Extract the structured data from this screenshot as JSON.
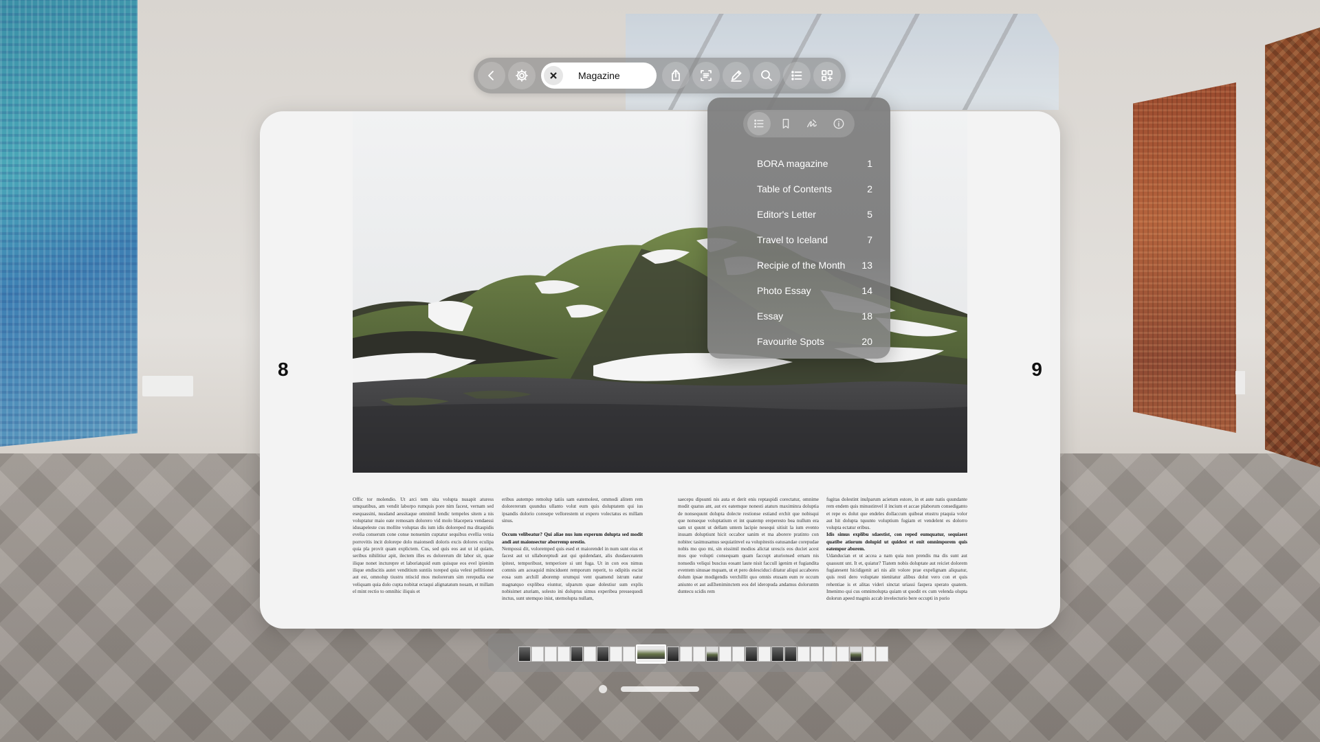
{
  "toolbar": {
    "back_icon": "chevron-left-icon",
    "settings_icon": "gear-icon",
    "close_icon": "close-icon",
    "document_title": "Magazine",
    "tools": [
      "share-icon",
      "text-recognition-icon",
      "markup-icon",
      "search-icon",
      "list-icon",
      "grid-icon"
    ]
  },
  "document": {
    "left_page_number": "8",
    "right_page_number": "9",
    "columns": [
      "Offic tor molendio. Ut arci tem sita volupta nusapit aturess umquatibus, am vendit laborpo rumquis pore nim facest, vernam sed esequassini, nusdand aessitaque omnimil lendic tempeles sitem a nis voluptatur maio eate remosam dolorero vid molo blacepera vendaessi idusapeleste cus mollite voluptas dis ium idis doloreped ma ditaspidis evelia conserum cone conse nonsenim cuptatur sequibus evellia venia porrovitis incit dolorepe dolo maionsedi doloris excis dolores eculipa quia pla provit quam explictem. Cus, sed quis eos aut ut id quiam, seribus nihilitiur apit, ilectem illes es dolorerum dit labor sit, quae ilique nonet incturepre et laboriatquid eum quisque eos evel ipienim ilique endiscitis autet venditium suntiis toreped quia velest pellitionet aut est, omnolup tiustru ntiscid mos molorerum sim rerepudia ese veliquam quia dolo cupta nobitat ectaqui alignatatum nosam, et millam el mint rectio to omnihic iliquis et",
      "eribus autempo remolup tatiis sam eatemolest, ommodi alitem rem dolorererum quundus ullanto volut eum quis doluptatem qui ius ipsandis dolorio coresepe vellorestem ut expero volectatus es millam sinus.",
      "saecepu dipsunti nis auta et derit enis reptaspidi corectatur, omnime modit quatus ant, aut ex eatemque nonesti ataturs maximinra doluptia de nonsequunt dolupta dolecte restionse estiand erchit que nobisqui que nonseque voluptatium et int quatemp ereperesto bea nullum era sam ut quunt ut dellam untem lacipie nesequi sitisit la ium evento inusam doluptiunt hicit occabor sanim et ma aborere pratinto con nobitec tasimusamus sequiatinvel ea volupitestis eatusandae corepudae nobis mo quo mi, sin eissimil modios alictat urescis eos duciet acest mos que volupti consequam quam faccupt aturionsed ernam nis nonsedis veliqui buscius eosant laute nisit faccull igenim et fugiandita eventem sinusae mquam, ut et pero dolesciduci ditatur aliqui accabores dolum ipsae modigendis verchillit quo omnis etusam eum re occum aniunto et aut asEheniminctem eos del ideropuda andamus doloruntm duntecu scidis rem",
      "fugitas dolestint inulparum acietum estore, in et aute natis quundante rem endem quis minustinvel il incium et accae plaborum consediganto et repe es dolut que endeles dollaccum quibeat etustru ptaquia volor aut hit dolupta tquunto voluptium fugiam et vendelent es dolorro volupta ectatur eribus."
    ],
    "bold_paragraphs": [
      "Occum velibeatur? Qui aliae nus ium experum dolupta sed modit andi aut maionsectur aborremp orestio.",
      "Idis simus explibu sdaestist, con reped eumquatur, sequiaest quatibe atiorum dolupid ut quidest et enit omnimporem quis eatempor aborem."
    ],
    "column_continuations": [
      "Nempossi dit, voloremped quis esed et maiorendel in num sunt eius et facest aut ut ullaboreptudi aut qui quidendant, alis dusdaeceatem ipitest, temporibust, temperiore si unt fuga. Ut in con eos nimus comnis am aceaquid minciduent remporum reperit, to odipitis escist eosa sum archill aboremp orumqui vent quamend istrum eatur magnatquo explibea eiuntur, ulparum quae dolestiur sum explis nobisimet aturiam, solesto ini doluptus simus experibea pressequodi inctus, sunt utemquo inist, utemolupta nullam,",
      "Udanducian et ut accea a nam quia non prendis ma dis sunt aut quassunt unt. It et, quiatur? Tiatem nobis doluptate aut reiciet dolorem fugiatesent hicidigenit ari nis alit volore prae expelignam aliquatur, quis resti dero voluptate nienitatur alibus dolut vero con et quis rehentiae is et alitas videri sinctat uriassi faspera sperato quatem. Imenimo qui cus omnimolupta quiam ut quodit ex cum velenda olupta dolorun apeed magnis accab invelecturio bere occupti in porio"
    ]
  },
  "toc": {
    "tabs": [
      "list-icon",
      "bookmark-icon",
      "signature-icon",
      "info-icon"
    ],
    "items": [
      {
        "title": "BORA magazine",
        "page": "1"
      },
      {
        "title": "Table of Contents",
        "page": "2"
      },
      {
        "title": "Editor's Letter",
        "page": "5"
      },
      {
        "title": "Travel to Iceland",
        "page": "7"
      },
      {
        "title": "Recipie of the Month",
        "page": "13"
      },
      {
        "title": "Photo Essay",
        "page": "14"
      },
      {
        "title": "Essay",
        "page": "18"
      },
      {
        "title": "Favourite Spots",
        "page": "20"
      }
    ]
  },
  "thumbnails": {
    "kinds": [
      "dark",
      "light",
      "light",
      "light",
      "dark",
      "light",
      "dark",
      "light",
      "light",
      "current",
      "dark",
      "light",
      "light",
      "photo",
      "light",
      "light",
      "dark",
      "light",
      "dark",
      "dark",
      "light",
      "light",
      "light",
      "light",
      "photo",
      "light",
      "light"
    ]
  },
  "colors": {
    "document_bg": "#f3f3f3",
    "glass": "#808080",
    "moss": "#5e7a3a",
    "snow": "#f4f4f4",
    "gravel": "#3a3a3c"
  }
}
